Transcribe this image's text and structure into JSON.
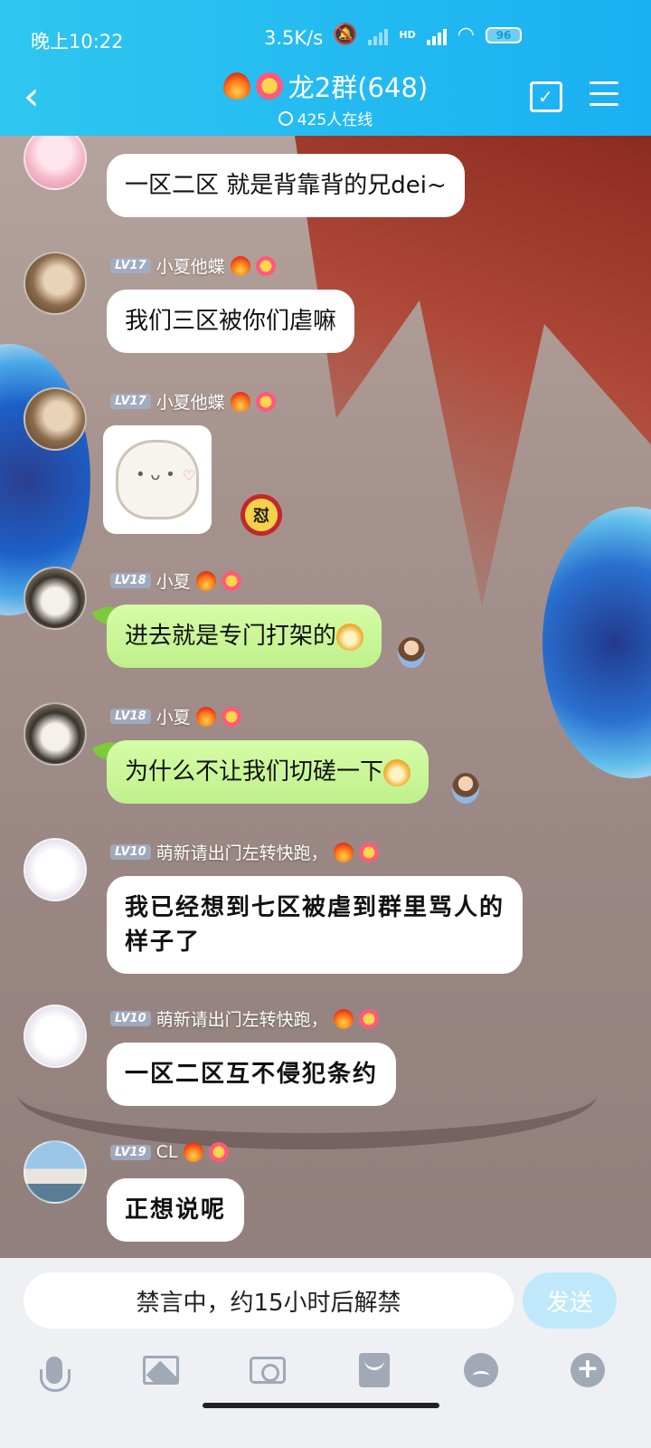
{
  "status_bar": {
    "time": "晚上10:22",
    "speed": "3.5K/s",
    "battery": "96",
    "network": "HD"
  },
  "header": {
    "title": "龙2群(648)",
    "online": "425人在线",
    "back_icon": "back-arrow-icon",
    "calendar_icon": "calendar-check-icon",
    "menu_icon": "hamburger-menu-icon"
  },
  "messages": [
    {
      "level": "",
      "name": "",
      "text": "一区二区 就是背靠背的兄dei~",
      "type": "text",
      "avatar": "pink-anime-avatar"
    },
    {
      "level": "LV17",
      "name": "小夏他蝶",
      "text": "我们三区被你们虐嘛",
      "type": "text",
      "avatar": "brown-hair-avatar"
    },
    {
      "level": "LV17",
      "name": "小夏他蝶",
      "text": "",
      "type": "sticker",
      "avatar": "brown-hair-avatar"
    },
    {
      "level": "LV18",
      "name": "小夏",
      "text": "进去就是专门打架的",
      "type": "green",
      "avatar": "cat-avatar"
    },
    {
      "level": "LV18",
      "name": "小夏",
      "text": "为什么不让我们切磋一下",
      "type": "green",
      "avatar": "cat-avatar"
    },
    {
      "level": "LV10",
      "name": "萌新请出门左转快跑，",
      "text": "我已经想到七区被虐到群里骂人的样子了",
      "type": "hand",
      "avatar": "white-hair-avatar"
    },
    {
      "level": "LV10",
      "name": "萌新请出门左转快跑，",
      "text": "一区二区互不侵犯条约",
      "type": "hand",
      "avatar": "white-hair-avatar"
    },
    {
      "level": "LV19",
      "name": "CL",
      "text": "正想说呢",
      "type": "hand",
      "avatar": "couple-photo-avatar"
    }
  ],
  "sticker_badge": "怼",
  "input": {
    "muted_text": "禁言中，约15小时后解禁",
    "send_label": "发送"
  },
  "toolbar": {
    "icons": [
      "microphone-icon",
      "image-icon",
      "camera-icon",
      "red-packet-icon",
      "emoji-icon",
      "plus-icon"
    ]
  },
  "colors": {
    "header_start": "#2fc6f0",
    "header_end": "#1ab0f2",
    "green_bubble": "#c9f79e",
    "send_button": "#bfe9fb"
  }
}
